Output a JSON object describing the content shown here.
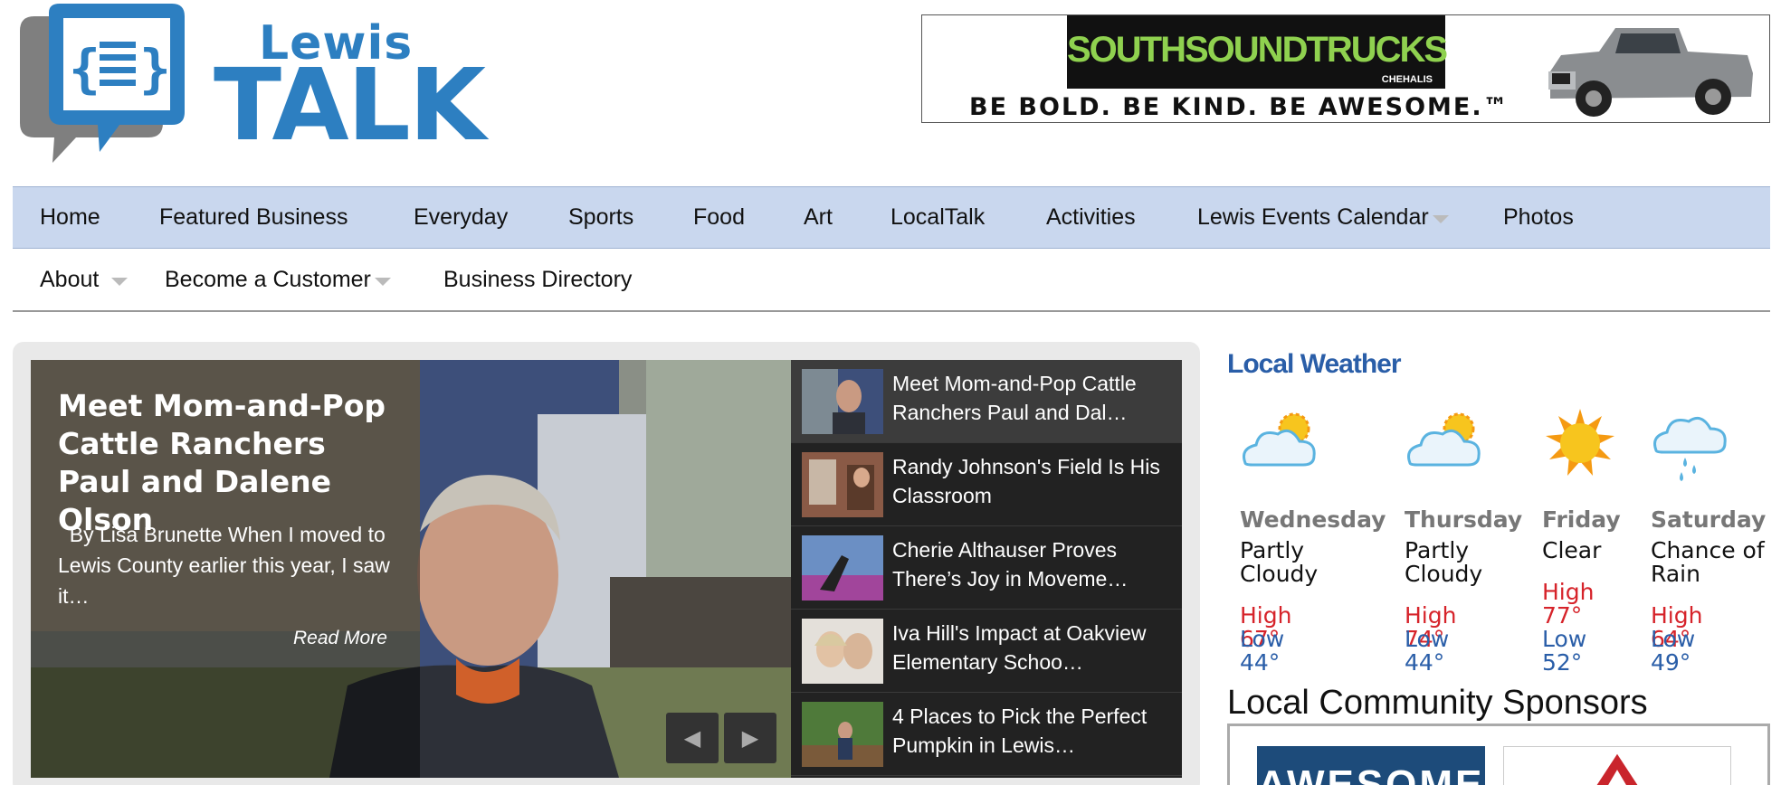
{
  "logo": {
    "line1": "Lewis",
    "line2": "TALK",
    "brand_color": "#2d7fc1"
  },
  "ad": {
    "brand": "SOUTHSOUNDTRUCKS",
    "brand_sub": "CHEHALIS",
    "tagline": "BE BOLD. BE KIND. BE AWESOME.™"
  },
  "nav": {
    "main": [
      {
        "label": "Home"
      },
      {
        "label": "Featured Business"
      },
      {
        "label": "Everyday"
      },
      {
        "label": "Sports"
      },
      {
        "label": "Food"
      },
      {
        "label": "Art"
      },
      {
        "label": "LocalTalk"
      },
      {
        "label": "Activities"
      },
      {
        "label": "Lewis Events Calendar",
        "has_dropdown": true
      },
      {
        "label": "Photos"
      }
    ],
    "sub": [
      {
        "label": "About",
        "has_dropdown": true
      },
      {
        "label": "Become a Customer",
        "has_dropdown": true
      },
      {
        "label": "Business Directory"
      }
    ]
  },
  "hero": {
    "title": "Meet Mom-and-Pop Cattle Ranchers Paul and Dalene Olson",
    "excerpt": "  By Lisa Brunette When I moved to Lewis County earlier this year, I saw it…",
    "read_more": "Read More",
    "prev_icon": "prev-arrow-icon",
    "next_icon": "next-arrow-icon"
  },
  "slides": [
    {
      "title": "Meet Mom-and-Pop Cattle Ranchers Paul and Dal…",
      "active": true
    },
    {
      "title": "Randy Johnson's Field Is His Classroom"
    },
    {
      "title": "Cherie Althauser Proves There’s Joy in Moveme…"
    },
    {
      "title": "Iva Hill's Impact at Oakview Elementary Schoo…"
    },
    {
      "title": "4 Places to Pick the Perfect Pumpkin in Lewis…"
    }
  ],
  "weather": {
    "title": "Local Weather",
    "days": [
      {
        "day": "Wednesday",
        "condition": "Partly Cloudy",
        "high": "High 67°",
        "low": "Low 44°",
        "icon": "partly-cloudy-icon"
      },
      {
        "day": "Thursday",
        "condition": "Partly Cloudy",
        "high": "High 74°",
        "low": "Low 44°",
        "icon": "partly-cloudy-icon"
      },
      {
        "day": "Friday",
        "condition": "Clear",
        "high": "High 77°",
        "low": "Low 52°",
        "icon": "sun-icon"
      },
      {
        "day": "Saturday",
        "condition": "Chance of Rain",
        "high": "High 64°",
        "low": "Low 49°",
        "icon": "rain-cloud-icon"
      }
    ]
  },
  "sponsors": {
    "title": "Local Community Sponsors",
    "first_sponsor_text": "AWESOME"
  },
  "colors": {
    "nav_bg": "#c9d7ee",
    "weather_title": "#2a5ea8",
    "high_temp": "#d6232a",
    "low_temp": "#2a5ea8"
  }
}
